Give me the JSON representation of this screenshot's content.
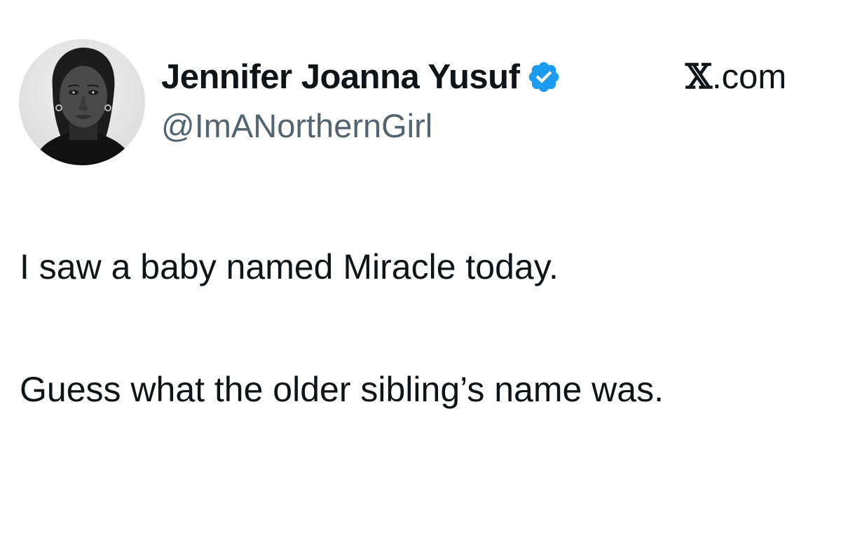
{
  "author": {
    "name": "Jennifer Joanna Yusuf",
    "handle": "@ImANorthernGirl",
    "verified_icon": "verified-badge-icon",
    "avatar": "avatar-photo"
  },
  "site": {
    "mark": "𝕏",
    "label": ".com"
  },
  "tweet": {
    "paragraphs": [
      "I saw a baby named Miracle today.",
      "Guess what the older sibling’s name was."
    ]
  },
  "colors": {
    "verified_blue": "#1d9bf0",
    "handle_gray": "#536471",
    "text": "#0f1419"
  }
}
